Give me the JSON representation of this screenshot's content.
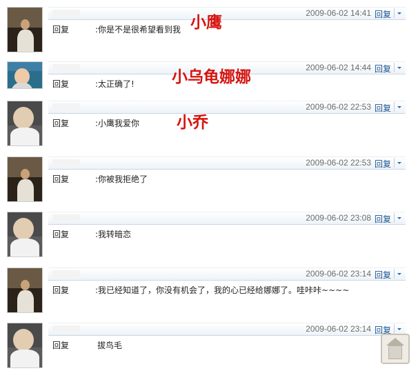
{
  "reply_label": "回复",
  "menu_link_label": "回复",
  "comments": [
    {
      "avatar": "avatar-dark",
      "time": "2009-06-02 14:41",
      "text": ":你是不是很希望看到我"
    },
    {
      "avatar": "avatar-color",
      "time": "2009-06-02 14:44",
      "text": ":太正确了!"
    },
    {
      "avatar": "avatar-boy",
      "time": "2009-06-02 22:53",
      "text": ":小鹰我爱你"
    },
    {
      "avatar": "avatar-dark",
      "time": "2009-06-02 22:53",
      "text": ":你被我拒绝了"
    },
    {
      "avatar": "avatar-boy",
      "time": "2009-06-02 23:08",
      "text": ":我转暗恋"
    },
    {
      "avatar": "avatar-dark",
      "time": "2009-06-02 23:14",
      "text": ":我已经知道了，你没有机会了，我的心已经给娜娜了。哇咔咔~~~~"
    },
    {
      "avatar": "avatar-boy",
      "time": "2009-06-02 23:14",
      "text": "拔鸟毛"
    }
  ],
  "annotations": [
    "小鹰",
    "小乌龟娜娜",
    "小乔"
  ],
  "colors": {
    "annotation": "#d6140f",
    "link": "#1b5592",
    "time": "#6b6b6b"
  },
  "icons": {
    "menu": "chevron-down-icon",
    "watermark": "house-watermark-icon"
  }
}
